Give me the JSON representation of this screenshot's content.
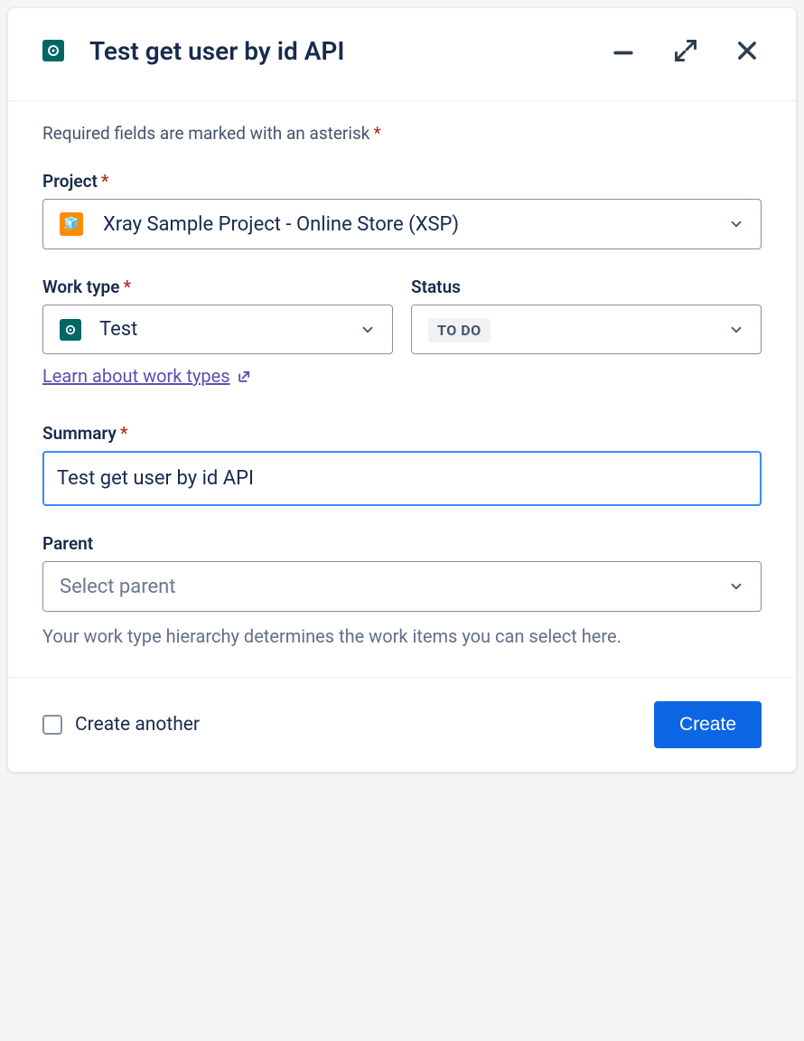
{
  "header": {
    "title": "Test get user by id API"
  },
  "body": {
    "required_note": "Required fields are marked with an asterisk",
    "project": {
      "label": "Project",
      "value": "Xray Sample Project - Online Store (XSP)"
    },
    "work_type": {
      "label": "Work type",
      "value": "Test",
      "learn_link": "Learn about work types"
    },
    "status": {
      "label": "Status",
      "value": "TO DO"
    },
    "summary": {
      "label": "Summary",
      "value": "Test get user by id API"
    },
    "parent": {
      "label": "Parent",
      "placeholder": "Select parent",
      "help": "Your work type hierarchy determines the work items you can select here."
    }
  },
  "footer": {
    "create_another": "Create another",
    "create_button": "Create"
  }
}
